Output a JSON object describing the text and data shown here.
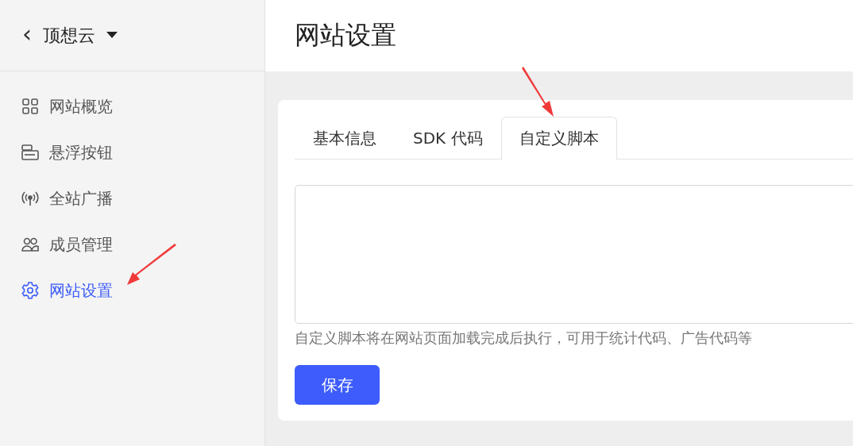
{
  "sidebar": {
    "back": "‹",
    "project": "顶想云",
    "items": [
      {
        "label": "网站概览",
        "selected": false
      },
      {
        "label": "悬浮按钮",
        "selected": false
      },
      {
        "label": "全站广播",
        "selected": false
      },
      {
        "label": "成员管理",
        "selected": false
      },
      {
        "label": "网站设置",
        "selected": true
      }
    ]
  },
  "page": {
    "title": "网站设置"
  },
  "tabs": [
    {
      "label": "基本信息",
      "selected": false
    },
    {
      "label": "SDK 代码",
      "selected": false
    },
    {
      "label": "自定义脚本",
      "selected": true
    }
  ],
  "script_field": {
    "hint": "自定义脚本将在网站页面加载完成后执行，可用于统计代码、广告代码等"
  },
  "save_button": "保存"
}
